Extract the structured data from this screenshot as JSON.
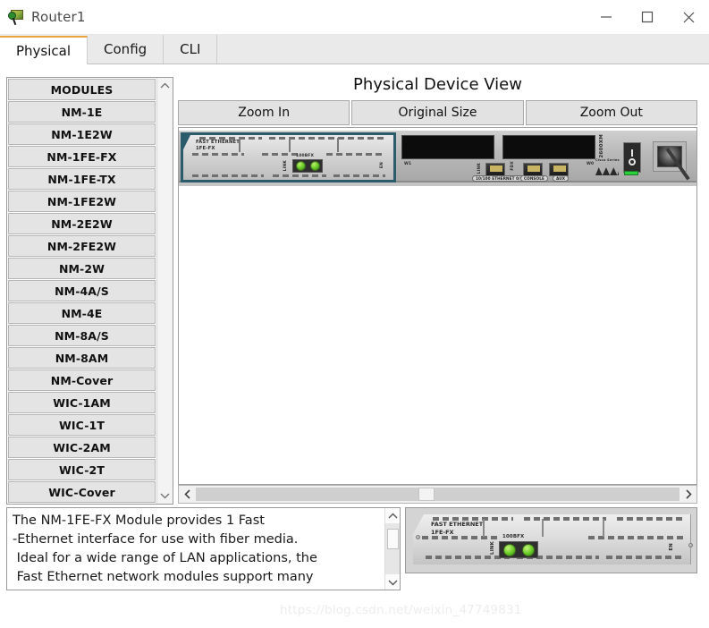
{
  "window": {
    "title": "Router1",
    "icon": "packet-tracer-icon",
    "controls": {
      "minimize": "minimize-icon",
      "maximize": "maximize-icon",
      "close": "close-icon"
    }
  },
  "tabs": [
    {
      "label": "Physical",
      "active": true
    },
    {
      "label": "Config",
      "active": false
    },
    {
      "label": "CLI",
      "active": false
    }
  ],
  "modules": {
    "header": "MODULES",
    "items": [
      "NM-1E",
      "NM-1E2W",
      "NM-1FE-FX",
      "NM-1FE-TX",
      "NM-1FE2W",
      "NM-2E2W",
      "NM-2FE2W",
      "NM-2W",
      "NM-4A/S",
      "NM-4E",
      "NM-8A/S",
      "NM-8AM",
      "NM-Cover",
      "WIC-1AM",
      "WIC-1T",
      "WIC-2AM",
      "WIC-2T",
      "WIC-Cover"
    ],
    "scroll_up": "chevron-up-icon",
    "scroll_down": "chevron-down-icon"
  },
  "device_view": {
    "title": "Physical Device View",
    "zoom_in": "Zoom In",
    "original_size": "Original Size",
    "zoom_out": "Zoom Out",
    "hscroll_left": "chevron-left-icon",
    "hscroll_right": "chevron-right-icon",
    "chassis": {
      "module_label_line1": "FAST ETHERNET",
      "module_label_line2": "1FE-FX",
      "led_speed": "100BFX",
      "led_link": "LINK",
      "enable_label": "EN",
      "port_group_label": "10/100 ETHERNET 0/0",
      "console_label": "CONSOLE",
      "aux_label": "AUX",
      "fdx_label": "FDX",
      "link_label": "LINK",
      "w1_label": "W1",
      "w0_label": "W0",
      "series_label": "2600XM",
      "sub_series_label": "Cisco Series"
    }
  },
  "description": {
    "text": "The NM-1FE-FX Module provides 1 Fast\n-Ethernet interface for use with fiber media.\n Ideal for a wide range of LAN applications, the\n Fast Ethernet network modules support many",
    "scroll_up": "chevron-up-icon",
    "scroll_down": "chevron-down-icon"
  },
  "preview": {
    "label_line1": "FAST ETHERNET",
    "label_line2": "1FE-FX",
    "speed_label": "100BFX",
    "link_label": "LINK",
    "enable_label": "EN"
  },
  "watermark": "https://blog.csdn.net/weixin_47749831",
  "colors": {
    "accent": "#e8a33d",
    "selected_module_border": "#2b5c6b",
    "led_green": "#63c424"
  }
}
